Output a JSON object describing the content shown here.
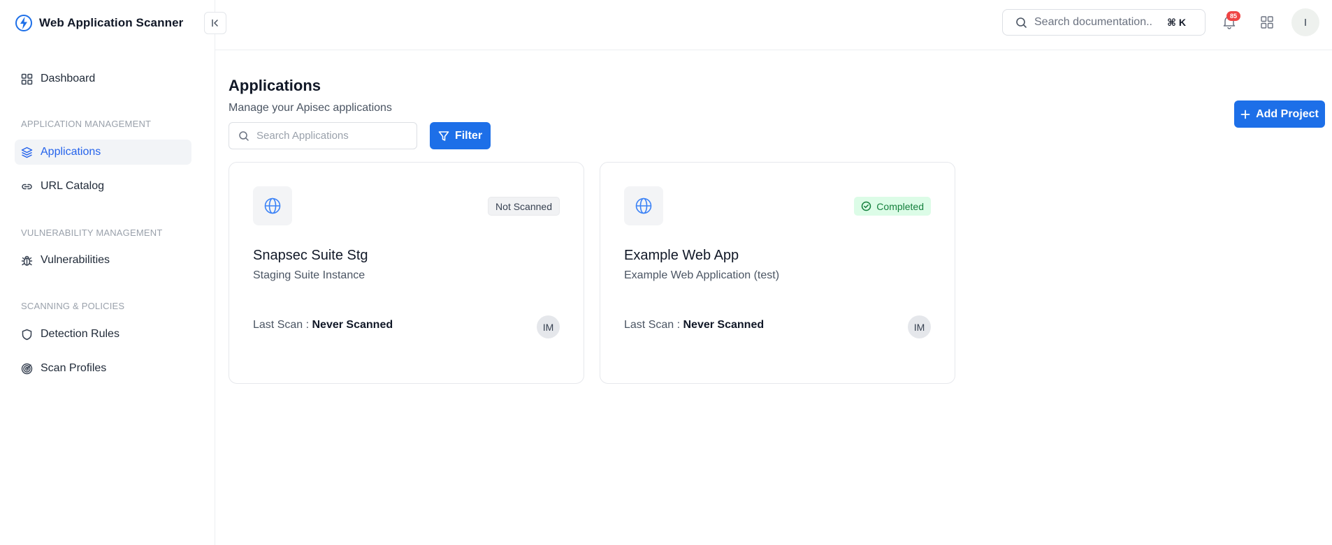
{
  "app": {
    "title": "Web Application Scanner",
    "brand_color": "#1d6fe8"
  },
  "sidebar": {
    "items": [
      {
        "label": "Dashboard",
        "icon": "grid-icon"
      },
      {
        "label": "Applications",
        "icon": "layers-icon",
        "active": true
      },
      {
        "label": "URL Catalog",
        "icon": "link-icon"
      },
      {
        "label": "Vulnerabilities",
        "icon": "bug-icon"
      },
      {
        "label": "Detection Rules",
        "icon": "shield-icon"
      },
      {
        "label": "Scan Profiles",
        "icon": "target-icon"
      }
    ],
    "sections": [
      {
        "label": "APPLICATION MANAGEMENT"
      },
      {
        "label": "VULNERABILITY MANAGEMENT"
      },
      {
        "label": "SCANNING & POLICIES"
      }
    ]
  },
  "topbar": {
    "search_placeholder": "Search documentation...",
    "shortcut": "⌘ K",
    "notifications_count": "85",
    "user_initial": "I"
  },
  "main": {
    "title": "Applications",
    "subtitle": "Manage your Apisec applications",
    "search_placeholder": "Search Applications",
    "filter_label": "Filter",
    "add_label": "Add Project",
    "cards": [
      {
        "name": "Snapsec Suite Stg",
        "description": "Staging Suite Instance",
        "status": "Not Scanned",
        "last_scan_label": "Last Scan :",
        "last_scan_value": "Never Scanned",
        "owner_initials": "IM"
      },
      {
        "name": "Example Web App",
        "description": "Example Web Application (test)",
        "status": "Completed",
        "status_color": "#15803d",
        "last_scan_label": "Last Scan :",
        "last_scan_value": "Never Scanned",
        "owner_initials": "IM"
      }
    ]
  }
}
